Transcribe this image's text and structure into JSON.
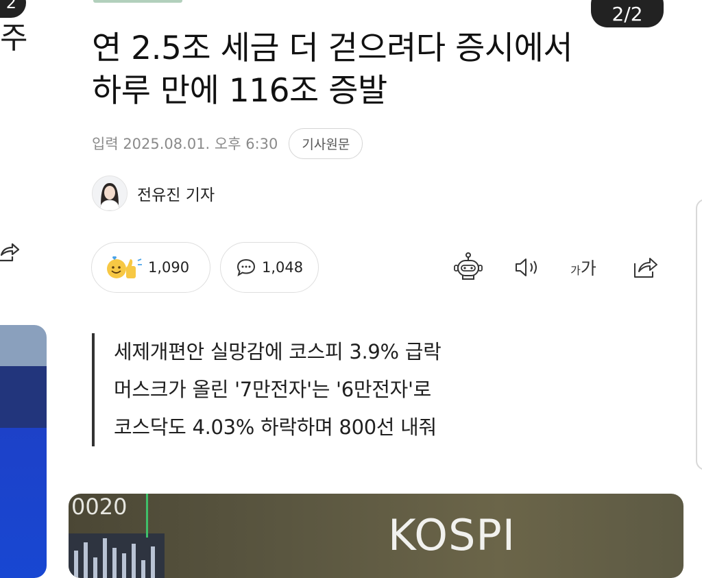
{
  "left_card": {
    "page_indicator": "2",
    "title_fragment": "주"
  },
  "right_card": {
    "page_indicator": "2/2"
  },
  "article": {
    "headline_line1": "연 2.5조 세금 더 걷으려다 증시에서",
    "headline_line2": "하루 만에 116조 증발",
    "published": "입력 2025.08.01. 오후 6:30",
    "original_article_label": "기사원문",
    "author": "전유진 기자",
    "reactions": {
      "likes_count": "1,090",
      "comments_count": "1,048"
    },
    "tools": {
      "font_size_label_small": "가",
      "font_size_label_large": "가"
    },
    "subheadings": [
      "세제개편안 실망감에 코스피 3.9% 급락",
      "머스크가 올린 '7만전자'는 '6만전자'로",
      "코스닥도 4.03% 하락하며 800선 내줘"
    ],
    "photo": {
      "ticker_text": "0020",
      "board_text": "KOSPI"
    }
  },
  "icons": [
    "share-icon",
    "smile-thumbs-icon",
    "comment-icon",
    "robot-summary-icon",
    "speaker-icon",
    "font-size-icon"
  ],
  "colors": {
    "badge_bg": "#222222",
    "text": "#1a1a1a",
    "meta_text": "#8a8a8a",
    "border": "#dedede"
  }
}
